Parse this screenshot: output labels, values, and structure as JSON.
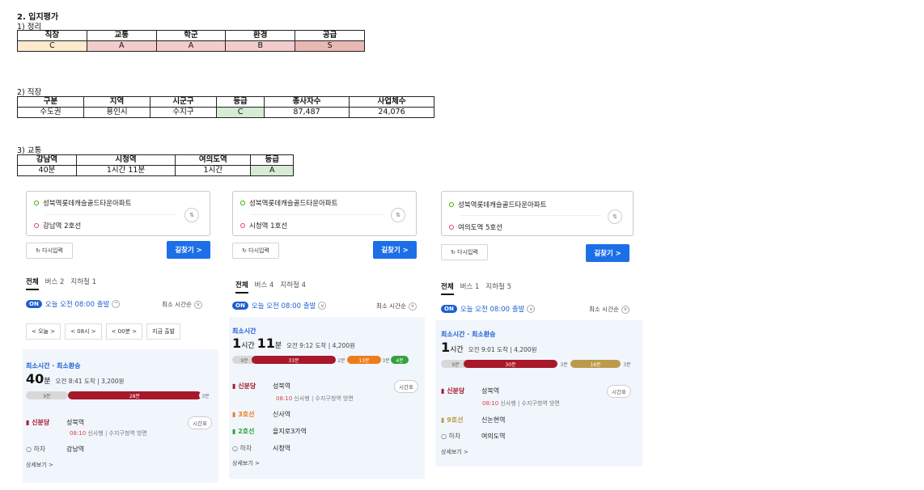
{
  "section_title": "2. 입지평가",
  "summary": {
    "title": "1) 정리",
    "headers": [
      "직장",
      "교통",
      "학군",
      "환경",
      "공급"
    ],
    "values": [
      "C",
      "A",
      "A",
      "B",
      "S"
    ],
    "colors": [
      "#fde9cc",
      "#f2cccc",
      "#f2cccc",
      "#f2cccc",
      "#e8b9b2"
    ]
  },
  "job": {
    "title": "2) 직장",
    "headers": [
      "구분",
      "지역",
      "시군구",
      "등급",
      "종사자수",
      "사업체수"
    ],
    "values": [
      "수도권",
      "용인시",
      "수지구",
      "C",
      "87,487",
      "24,076"
    ]
  },
  "transit": {
    "title": "3) 교통",
    "headers": [
      "강남역",
      "시청역",
      "여의도역",
      "등급"
    ],
    "values": [
      "40분",
      "1시간 11분",
      "1시간",
      "A"
    ]
  },
  "routes": [
    {
      "origin": "성북역롯데캐슬골드타운아파트",
      "dest": "강남역 2호선",
      "reset": "다시입력",
      "find": "길찾기 >",
      "tabs": [
        "전체",
        "버스 2",
        "지하철 1"
      ],
      "on": "ON",
      "depart": "오늘 오전 08:00 출발",
      "sort": "최소 시간순",
      "nav": [
        "<  오늘  >",
        "<  08시  >",
        "<  00분  >",
        "지금 출발"
      ],
      "label": "최소시간 · 최소환승",
      "dur_num": "40",
      "dur_unit": "분",
      "meta": "오전 8:41 도착 | 3,200원",
      "segments": [
        "9분",
        "28분",
        "3분"
      ],
      "steps": [
        {
          "line": "신분당",
          "station": "성북역"
        },
        {
          "line": "하차",
          "station": "강남역"
        }
      ],
      "sub_time": "08:10",
      "sub_text": "신사행 | 수지구청역 방면",
      "timetable": "시간표",
      "more": "상세보기 >"
    },
    {
      "origin": "성북역롯데캐슬골드타운아파트",
      "dest": "시청역 1호선",
      "reset": "다시입력",
      "find": "길찾기 >",
      "tabs": [
        "전체",
        "버스 4",
        "지하철 4"
      ],
      "on": "ON",
      "depart": "오늘 오전 08:00 출발",
      "sort": "최소 시간순",
      "label": "최소시간",
      "dur_h": "1",
      "dur_h_unit": "시간",
      "dur_m": "11",
      "dur_m_unit": "분",
      "meta": "오전 9:12 도착 | 4,200원",
      "segments": [
        "9분",
        "33분",
        "2분",
        "13분",
        "3분",
        "4분"
      ],
      "steps": [
        {
          "line": "신분당",
          "station": "성북역"
        },
        {
          "line": "3호선",
          "station": "신사역"
        },
        {
          "line": "2호선",
          "station": "을지로3가역"
        },
        {
          "line": "하차",
          "station": "시청역"
        }
      ],
      "sub_time": "08:10",
      "sub_text": "신사행 | 수지구청역 방면",
      "timetable": "시간표",
      "more": "상세보기 >"
    },
    {
      "origin": "성북역롯데캐슬골드타운아파트",
      "dest": "여의도역 5호선",
      "reset": "다시입력",
      "find": "길찾기 >",
      "tabs": [
        "전체",
        "버스 1",
        "지하철 5"
      ],
      "on": "ON",
      "depart": "오늘 오전 08:00 출발",
      "sort": "최소 시간순",
      "label": "최소시간 · 최소환승",
      "dur_h": "1",
      "dur_h_unit": "시간",
      "meta": "오전 9:01 도착 | 4,200원",
      "segments": [
        "9분",
        "30분",
        "3분",
        "16분",
        "3분"
      ],
      "steps": [
        {
          "line": "신분당",
          "station": "성북역"
        },
        {
          "line": "9호선",
          "station": "신논현역"
        },
        {
          "line": "하차",
          "station": "여의도역"
        }
      ],
      "sub_time": "08:10",
      "sub_text": "신사행 | 수지구청역 방면",
      "timetable": "시간표",
      "more": "상세보기 >"
    }
  ],
  "colors": {
    "shinbundang": "#a6182a",
    "line3": "#ef7c1c",
    "line2": "#33a23d",
    "line9": "#bd9a4b",
    "accent": "#1d6fe8"
  }
}
